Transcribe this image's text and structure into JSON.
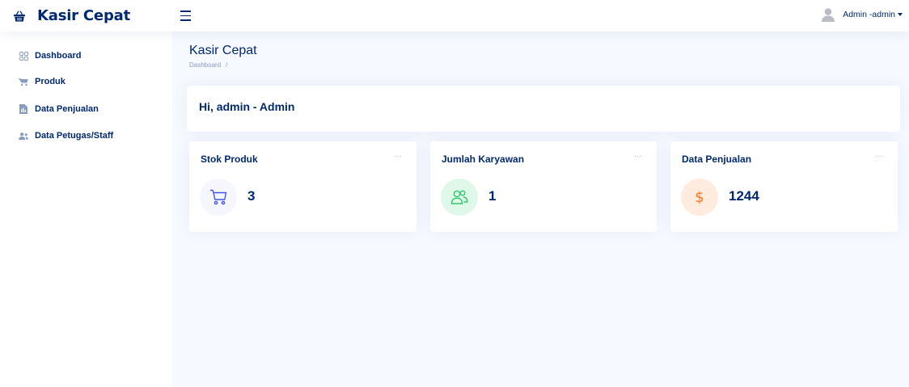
{
  "app": {
    "title": "Kasir Cepat"
  },
  "header": {
    "user_label": "Admin -admin"
  },
  "sidebar": {
    "items": [
      {
        "label": "Dashboard",
        "icon": "grid-icon"
      },
      {
        "label": "Produk",
        "icon": "cart-icon"
      },
      {
        "label": "Data Penjualan",
        "icon": "document-icon"
      },
      {
        "label": "Data Petugas/Staff",
        "icon": "people-icon"
      }
    ]
  },
  "page": {
    "title": "Kasir Cepat",
    "breadcrumb": {
      "item": "Dashboard",
      "separator": "/"
    }
  },
  "welcome": {
    "text": "Hi, admin - Admin"
  },
  "stats": [
    {
      "title": "Stok Produk",
      "value": "3",
      "icon": "cart-icon",
      "icon_bg": "#f6f6fe",
      "icon_color": "#4154f1"
    },
    {
      "title": "Jumlah Karyawan",
      "value": "1",
      "icon": "people-icon",
      "icon_bg": "#e0f8e9",
      "icon_color": "#2eca6a"
    },
    {
      "title": "Data Penjualan",
      "value": "1244",
      "icon": "dollar-icon",
      "icon_bg": "#ffecdf",
      "icon_color": "#ff771d"
    }
  ],
  "menu_dots": "...",
  "colors": {
    "primary_text": "#012970",
    "background": "#f6f9ff",
    "muted": "#899bbd"
  }
}
